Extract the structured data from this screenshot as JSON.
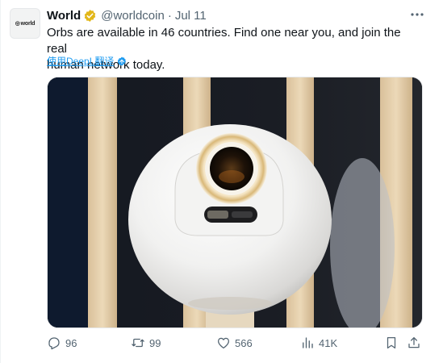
{
  "tweet": {
    "avatar_text": "world",
    "author_name": "World",
    "handle": "@worldcoin",
    "separator": "·",
    "date": "Jul 11",
    "text": "Orbs are available in 46 countries. Find one near you, and join the real\nhuman network today.",
    "translate_link": "使用DeepL翻译",
    "media_description_icon": "orb-photo",
    "actions": {
      "replies": "96",
      "reposts": "99",
      "likes": "566",
      "views": "41K"
    }
  },
  "colors": {
    "accent": "#1d9bf0",
    "muted": "#536471",
    "verified_gold": "#e2b719"
  },
  "icons": [
    "more-icon",
    "verified-icon",
    "translate-icon",
    "reply-icon",
    "repost-icon",
    "like-icon",
    "views-icon",
    "bookmark-icon",
    "share-icon"
  ]
}
